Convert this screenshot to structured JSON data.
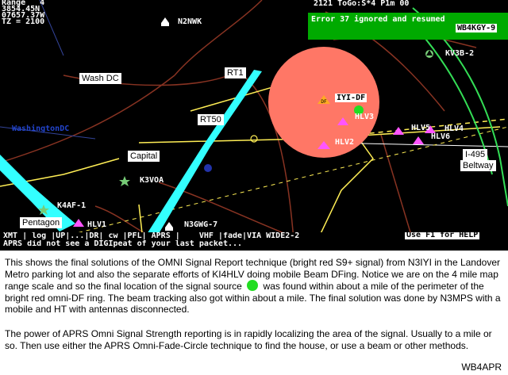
{
  "hud": {
    "range_label": "Range   4",
    "lat": "3854.45N",
    "lon": "07657.37W",
    "tz": "TZ = 2100",
    "top_status": "2121 ToGo:S*4 P1m 00",
    "error_msg": "Error 37 ignored and resumed",
    "error_call": "WB4KGY-9"
  },
  "map_labels": {
    "wash_dc": "Wash DC",
    "rt1": "RT1",
    "rt50": "RT50",
    "capital": "Capital",
    "pentagon": "Pentagon",
    "i495": "I-495",
    "beltway": "Beltway",
    "washington_dc_city": "WashingtonDC"
  },
  "stations": {
    "n2nwk": "N2NWK",
    "kv3b2": "KV3B-2",
    "n3iyi_df": "IYI-DF",
    "hlv3": "HLV3",
    "hlv5": "HLV5",
    "hlv4": "HLV4",
    "hlv6": "HLV6",
    "hlv2": "HLV2",
    "k3voa": "K3VOA",
    "k4af1": "K4AF-1",
    "hlv1": "HLV1",
    "n3gwg7": "N3GWG-7"
  },
  "statusbar": {
    "line1": "XMT | log |UP|...|DR| cw |PFL| APRS |    VHF |fade|VIA WIDE2-2",
    "help": "Use F1 for HELP",
    "line2": "APRS did not see a DIGIpeat of your last packet..."
  },
  "caption": {
    "para1": "This shows the final solutions of the OMNI Signal Report technique (bright red S9+ signal) from N3IYI in the Landover Metro parking lot and also the separate efforts of KI4HLV doing mobile Beam DFing.  Notice we are on the 4 mile map range  scale and so the  final location of the signal source",
    "para1b": "was found within about a mile  of the perimeter of the bright red omni-DF ring.  The beam tracking also got within about a mile.  The final  solution was done by N3MPS with a mobile and HT with antennas disconnected.",
    "para2": "The power of APRS Omni Signal Strength reporting is in rapidly localizing the area of the signal.  Usually to a mile or so.  Then use either the APRS Omni-Fade-Circle technique to find the house, or use a beam or other methods.",
    "credit": "WB4APR"
  },
  "colors": {
    "map_bg": "#000000",
    "omni_ring": "#ff7766",
    "roads": "#ffee55",
    "river": "#33ffff",
    "beltway": "#33dd55",
    "boundaries": "#883322",
    "hud_green": "#00aa00",
    "signal_source": "#22dd22"
  }
}
